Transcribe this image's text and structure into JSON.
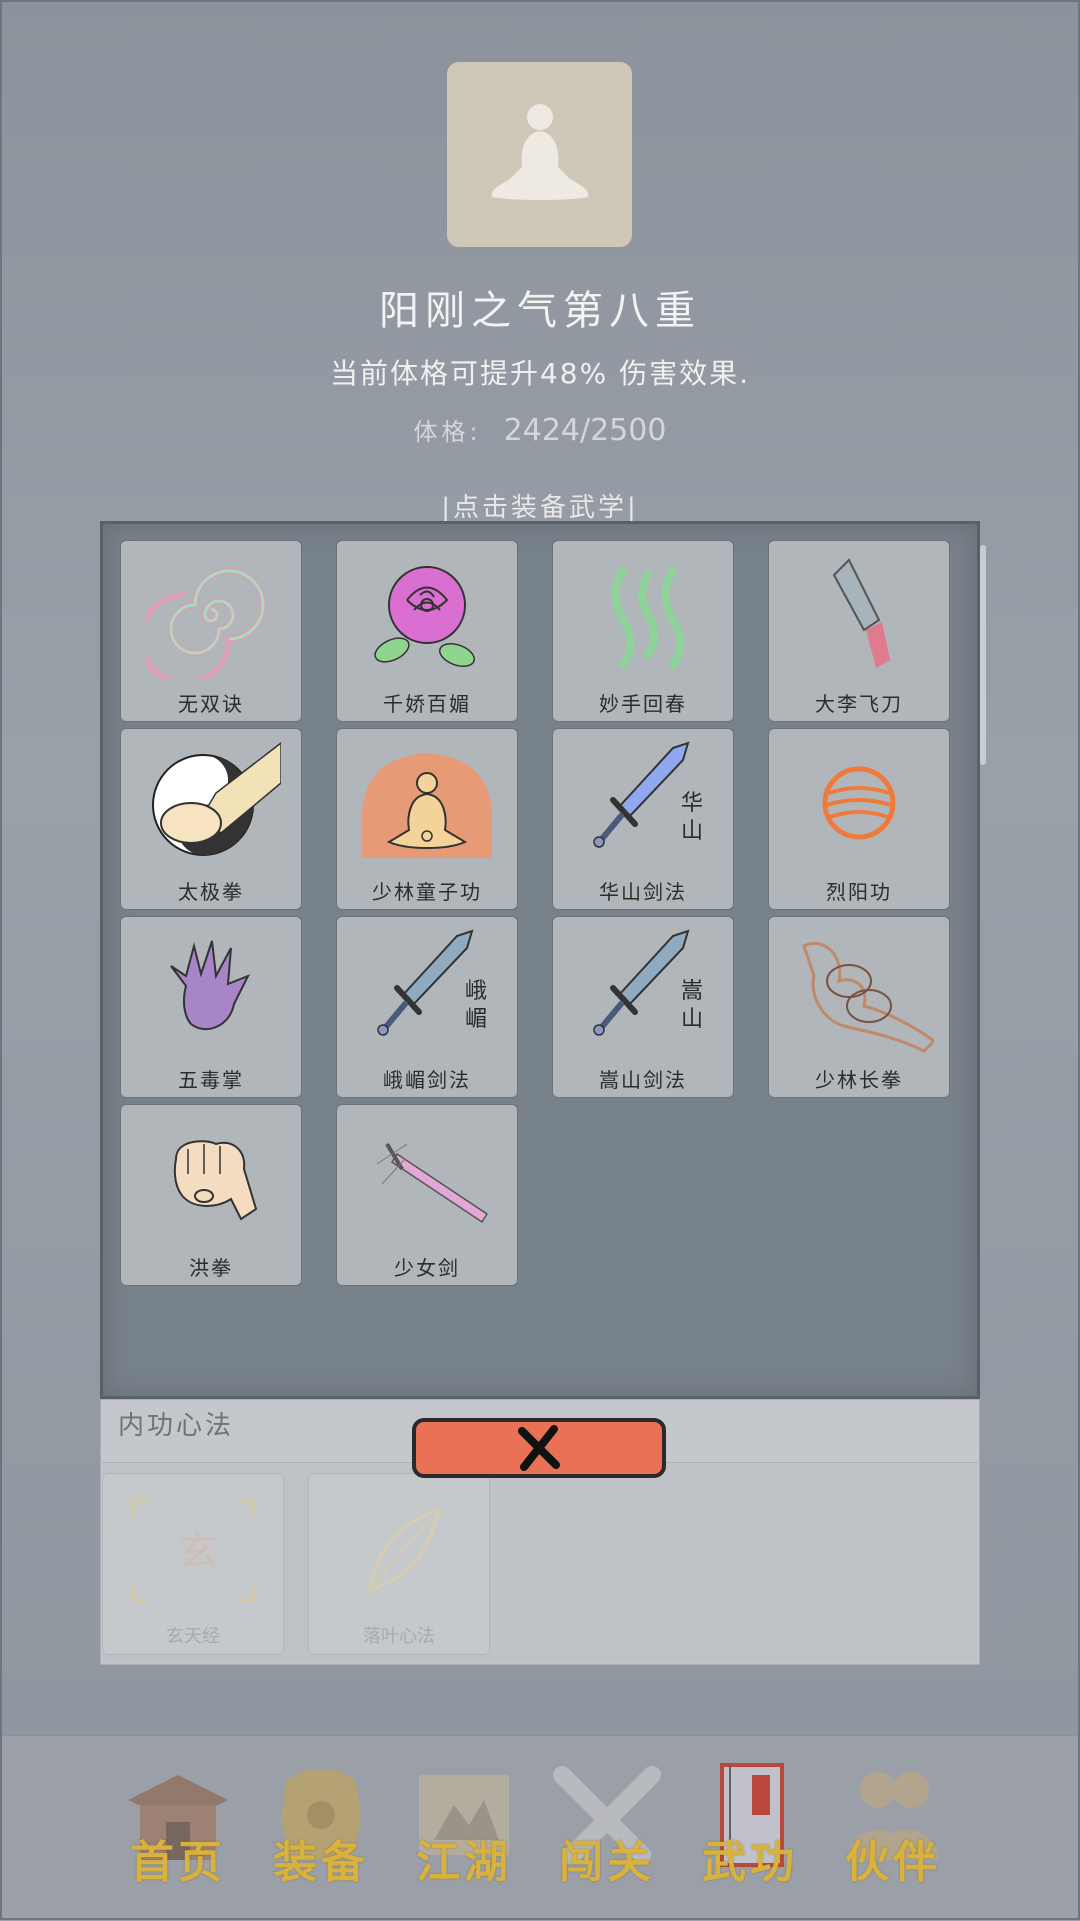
{
  "header": {
    "title": "阳刚之气第八重",
    "description": "当前体格可提升48% 伤害效果.",
    "stat_label": "体格:",
    "stat_value": "2424/2500",
    "hint": "|点击装备武学|"
  },
  "skills": [
    {
      "name": "无双诀",
      "icon": "spiral-icon"
    },
    {
      "name": "千娇百媚",
      "icon": "rose-icon"
    },
    {
      "name": "妙手回春",
      "icon": "healing-mist-icon"
    },
    {
      "name": "大李飞刀",
      "icon": "flying-knife-icon"
    },
    {
      "name": "太极拳",
      "icon": "taiji-fist-icon"
    },
    {
      "name": "少林童子功",
      "icon": "meditating-monk-icon"
    },
    {
      "name": "华山剑法",
      "icon": "sword-icon",
      "sword_text": "华山"
    },
    {
      "name": "烈阳功",
      "icon": "sun-orb-icon"
    },
    {
      "name": "五毒掌",
      "icon": "poison-palm-icon"
    },
    {
      "name": "峨嵋剑法",
      "icon": "sword-icon",
      "sword_text": "峨嵋"
    },
    {
      "name": "嵩山剑法",
      "icon": "sword-icon",
      "sword_text": "嵩山"
    },
    {
      "name": "少林长拳",
      "icon": "fists-icon"
    },
    {
      "name": "洪拳",
      "icon": "fist-icon"
    },
    {
      "name": "少女剑",
      "icon": "pink-sword-icon"
    }
  ],
  "inner": {
    "header": "内功心法",
    "items": [
      {
        "name": "玄天经",
        "icon": "scroll-glyph-icon"
      },
      {
        "name": "落叶心法",
        "icon": "leaf-icon"
      }
    ]
  },
  "close_icon": "close-icon",
  "nav": [
    {
      "label": "首页",
      "icon": "temple-icon"
    },
    {
      "label": "装备",
      "icon": "armor-icon"
    },
    {
      "label": "江湖",
      "icon": "map-scroll-icon"
    },
    {
      "label": "闯关",
      "icon": "crossed-swords-icon"
    },
    {
      "label": "武功",
      "icon": "book-icon"
    },
    {
      "label": "伙伴",
      "icon": "companions-icon"
    }
  ],
  "colors": {
    "close_button": "#e87156",
    "nav_label": "#d8b23d",
    "panel": "#78828a"
  }
}
